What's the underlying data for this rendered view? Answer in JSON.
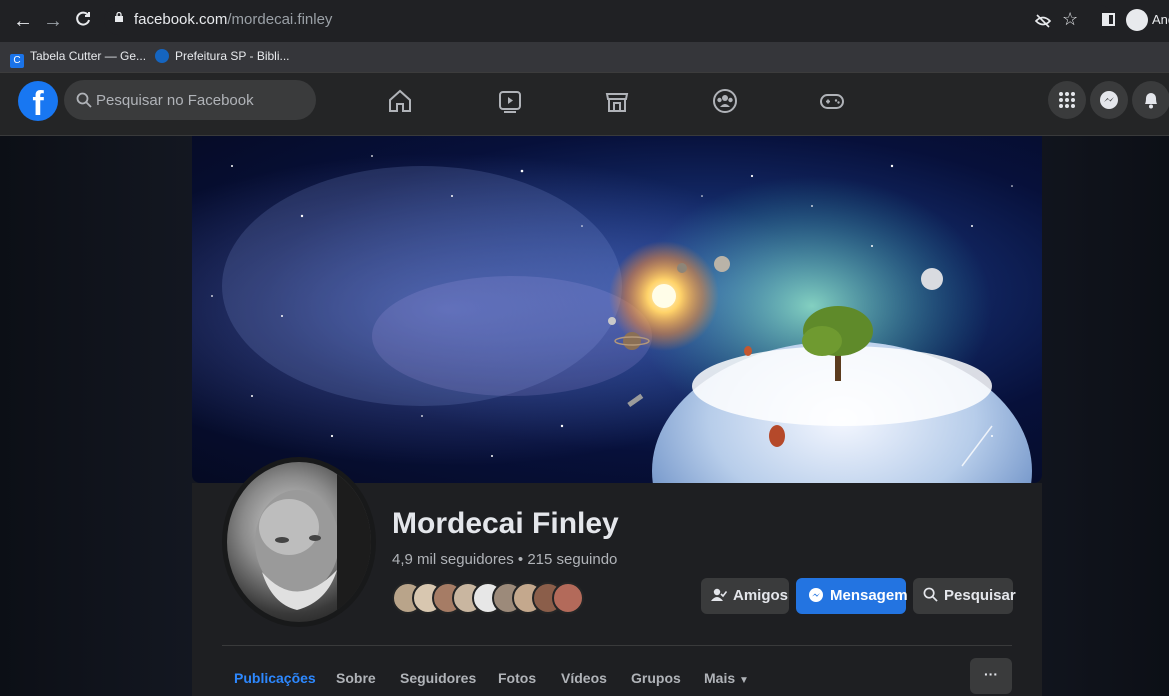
{
  "browser": {
    "url_host": "facebook.com",
    "url_path": "/mordecai.finley",
    "profile_label": "And",
    "bookmarks": [
      {
        "label": "Tabela Cutter — Ge...",
        "icon": "cutter-favicon",
        "color": "#1a73e8"
      },
      {
        "label": "Prefeitura SP - Bibli...",
        "icon": "prefeitura-favicon",
        "color": "#1565c0"
      }
    ]
  },
  "facebook": {
    "logo": "f",
    "search_placeholder": "Pesquisar no Facebook",
    "nav_icons": [
      "home-icon",
      "watch-icon",
      "marketplace-icon",
      "groups-icon",
      "gaming-icon"
    ],
    "right_icons": [
      "menu-grid-icon",
      "messenger-icon",
      "notifications-icon"
    ]
  },
  "profile": {
    "name": "Mordecai Finley",
    "stats": "4,9 mil seguidores • 215 seguindo",
    "friend_avatar_colors": [
      "#b9a48a",
      "#d8c7b0",
      "#a67c65",
      "#c9b6a0",
      "#e7e7e7",
      "#9c8a7a",
      "#c4a88d",
      "#8b5e4a",
      "#b36a5a"
    ],
    "buttons": {
      "friends": "Amigos",
      "message": "Mensagem",
      "search": "Pesquisar"
    },
    "tabs": [
      {
        "label": "Publicações",
        "active": true
      },
      {
        "label": "Sobre",
        "active": false
      },
      {
        "label": "Seguidores",
        "active": false
      },
      {
        "label": "Fotos",
        "active": false
      },
      {
        "label": "Vídeos",
        "active": false
      },
      {
        "label": "Grupos",
        "active": false
      },
      {
        "label": "Mais",
        "active": false
      }
    ],
    "more_dots": "···"
  },
  "colors": {
    "accent": "#2374e1",
    "active_tab": "#2d88ff",
    "fb_blue": "#1877f2"
  }
}
